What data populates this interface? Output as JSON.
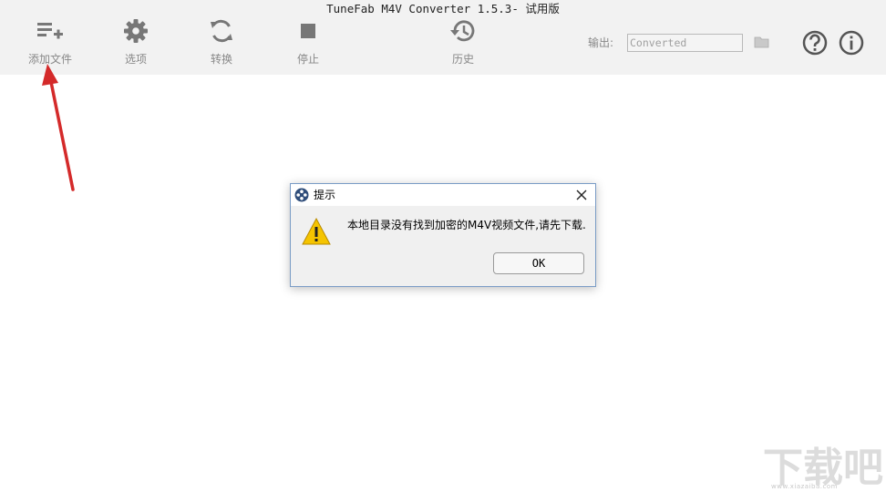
{
  "window": {
    "title": "TuneFab M4V Converter 1.5.3- 试用版"
  },
  "toolbar": {
    "add_files": {
      "label": "添加文件",
      "icon": "playlist-add-icon"
    },
    "options": {
      "label": "选项",
      "icon": "gear-icon"
    },
    "convert": {
      "label": "转换",
      "icon": "sync-icon"
    },
    "stop": {
      "label": "停止",
      "icon": "stop-icon"
    },
    "history": {
      "label": "历史",
      "icon": "history-icon"
    }
  },
  "output": {
    "label": "输出:",
    "value": "Converted",
    "folder_icon": "folder-icon"
  },
  "help_icon": "help-icon",
  "info_icon": "info-icon",
  "dialog": {
    "title": "提示",
    "message": "本地目录没有找到加密的M4V视频文件,请先下载.",
    "ok_label": "OK",
    "icon": "warning-icon"
  },
  "watermark": {
    "text": "下载吧",
    "url": "www.xiazaiba.com"
  },
  "colors": {
    "toolbar_bg": "#f2f2f2",
    "icon_gray": "#777777",
    "arrow_red": "#d42a2a",
    "warning_yellow": "#f5c400"
  }
}
